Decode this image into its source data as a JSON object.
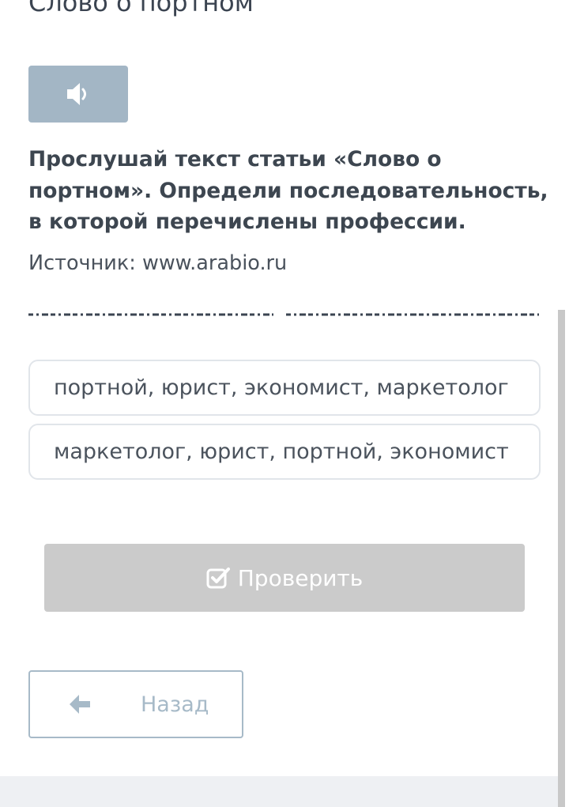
{
  "page": {
    "title": "Слово о портном"
  },
  "audio": {
    "icon": "speaker-icon",
    "color": "#a3b6c5"
  },
  "question": {
    "text": "Прослушай текст статьи «Слово о портном». Определи последовательность, в которой перечислены профессии.",
    "source": "Источник: www.arabio.ru"
  },
  "options": [
    {
      "label": "портной, юрист, экономист, маркетолог"
    },
    {
      "label": "маркетолог, юрист, портной, экономист"
    }
  ],
  "actions": {
    "check_label": "Проверить",
    "check_icon": "checkbox-icon",
    "check_color": "#cbcbcb",
    "back_label": "Назад",
    "back_icon": "arrow-left-icon",
    "back_color": "#a7bac8"
  }
}
